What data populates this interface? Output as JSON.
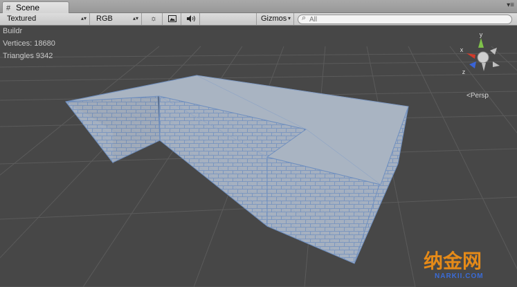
{
  "tab": {
    "title": "Scene",
    "icon": "scene-grid-icon"
  },
  "toolbar": {
    "render_mode": "Textured",
    "color_mode": "RGB",
    "gizmos_label": "Gizmos",
    "search_placeholder": "All",
    "icons": [
      "sun-lighting-icon",
      "image-skybox-icon",
      "speaker-audio-icon"
    ]
  },
  "stats": {
    "object_name": "Buildr",
    "vertices": "Vertices: 18680",
    "triangles": "Triangles 9342"
  },
  "gizmo": {
    "y_label": "y",
    "x_label": "x",
    "z_label": "z",
    "projection": "Persp"
  },
  "watermark": {
    "main": "纳金网",
    "sub": "NARKII.COM"
  },
  "colors": {
    "background": "#474747",
    "grid": "#5a5a5a",
    "mesh_face": "#a9b4c2",
    "wireframe": "#6f8fbf",
    "axis_y": "#7fc24a",
    "axis_x": "#d23a2a",
    "axis_z": "#3a64d6",
    "watermark": "#e58a18"
  }
}
